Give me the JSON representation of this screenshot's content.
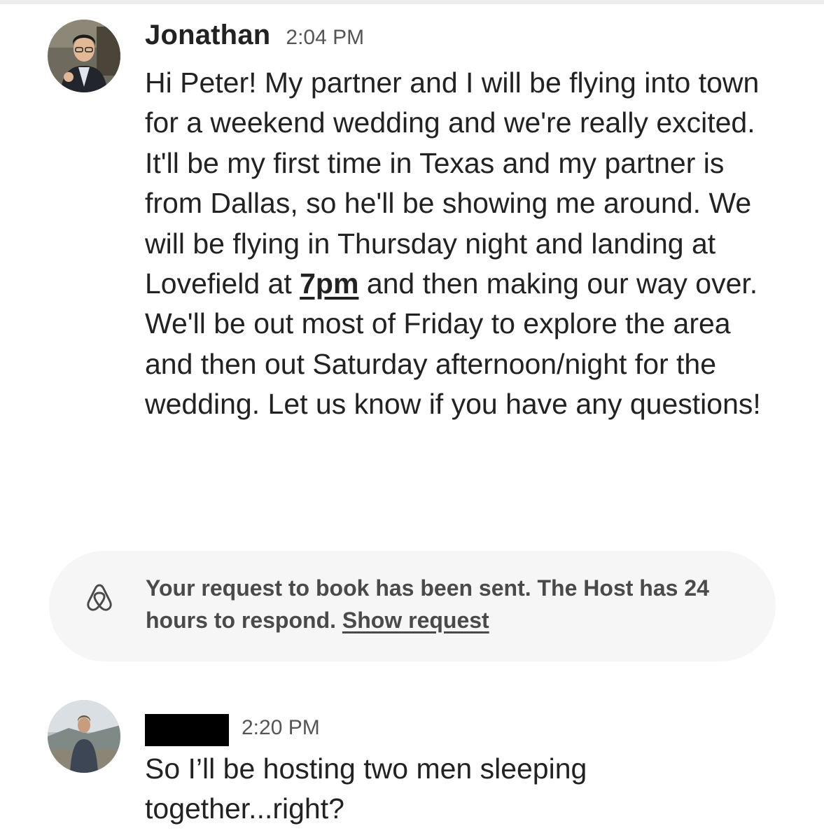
{
  "messages": [
    {
      "sender": "Jonathan",
      "time": "2:04 PM",
      "text_before_link": "Hi Peter! My partner and I will be flying into town for a weekend wedding and we're really excited. It'll be my first time in Texas and my partner is from Dallas, so he'll be showing me around. We will be flying in Thursday night and landing at Lovefield at ",
      "time_link": "7pm",
      "text_after_link": " and then making our way over. We'll be out most of Friday to explore the area and then out Saturday afternoon/night for the wedding. Let us know if you have any questions!"
    },
    {
      "time": "2:20 PM",
      "text": "So I’ll be hosting two men sleeping together...right?"
    }
  ],
  "system_notice": {
    "icon": "airbnb-logo-icon",
    "text": "Your request to book has been sent. The Host has 24 hours to respond. ",
    "link": "Show request"
  },
  "colors": {
    "text": "#222222",
    "muted": "#555555",
    "notice_bg": "#f6f6f6",
    "redaction": "#000000"
  }
}
